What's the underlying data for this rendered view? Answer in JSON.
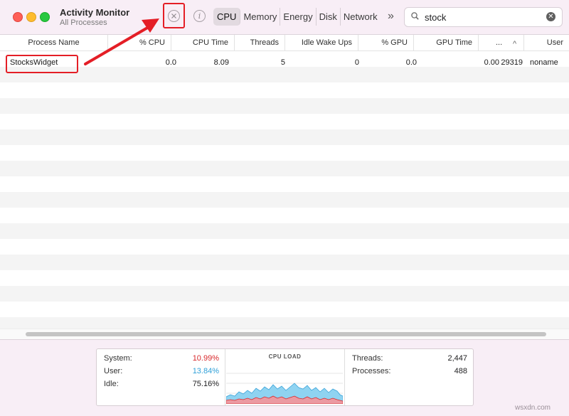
{
  "window": {
    "title": "Activity Monitor",
    "subtitle": "All Processes"
  },
  "toolbar": {
    "stop_icon": "x-circle-icon",
    "info_icon": "info-icon",
    "info_glyph": "i",
    "tabs": [
      "CPU",
      "Memory",
      "Energy",
      "Disk",
      "Network"
    ],
    "active_tab": "CPU",
    "more_glyph": "»",
    "search": {
      "value": "stock",
      "placeholder": "Search"
    }
  },
  "table": {
    "columns": [
      "Process Name",
      "% CPU",
      "CPU Time",
      "Threads",
      "Idle Wake Ups",
      "% GPU",
      "GPU Time",
      "...",
      "User"
    ],
    "rows": [
      {
        "process_name": "StocksWidget",
        "cpu_percent": "0.0",
        "cpu_time": "8.09",
        "threads": "5",
        "idle_wake_ups": "0",
        "gpu_percent": "0.0",
        "gpu_time": "0.00",
        "pid": "29319",
        "user": "noname"
      }
    ],
    "sort_indicator": "^"
  },
  "cpu_stats": {
    "system_label": "System:",
    "system_value": "10.99%",
    "user_label": "User:",
    "user_value": "13.84%",
    "idle_label": "Idle:",
    "idle_value": "75.16%",
    "graph_title": "CPU LOAD",
    "threads_label": "Threads:",
    "threads_value": "2,447",
    "processes_label": "Processes:",
    "processes_value": "488"
  },
  "colors": {
    "system": "#d8282b",
    "user": "#2fa0d8",
    "annotation": "#e41e26",
    "graph_user_fill": "#8fd3f1",
    "graph_system_fill": "#eb9aa2"
  },
  "watermark": "wsxdn.com"
}
